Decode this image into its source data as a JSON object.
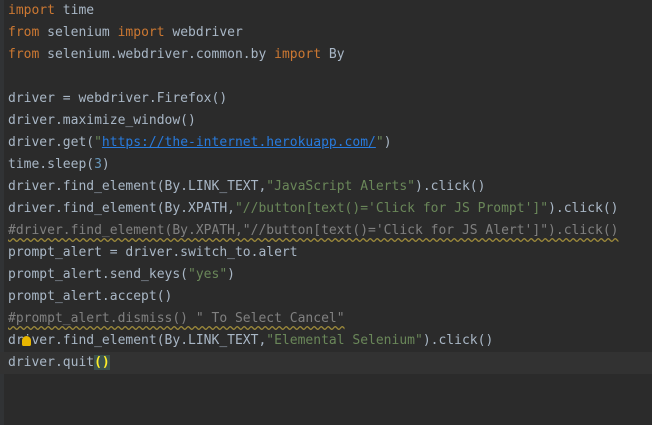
{
  "colors": {
    "background": "#2b2b2b",
    "keyword": "#cc7832",
    "string": "#6a8759",
    "comment": "#808080",
    "link": "#287bde",
    "default": "#a9b7c6"
  },
  "code": {
    "l1": {
      "kw1": "import",
      "rest": " time"
    },
    "l2": {
      "kw1": "from",
      "mid": " selenium ",
      "kw2": "import",
      "rest": " webdriver"
    },
    "l3": {
      "kw1": "from",
      "mid": " selenium.webdriver.common.by ",
      "kw2": "import",
      "rest": " By"
    },
    "l5": "driver = webdriver.Firefox()",
    "l6": "driver.maximize_window()",
    "l7": {
      "pre": "driver.get(",
      "q1": "\"",
      "url": "https://the-internet.herokuapp.com/",
      "q2": "\"",
      "post": ")"
    },
    "l8": {
      "pre": "time.sleep(",
      "num": "3",
      "post": ")"
    },
    "l9": {
      "pre": "driver.find_element(By.LINK_TEXT,",
      "str": "\"JavaScript Alerts\"",
      "post": ").click()"
    },
    "l10": {
      "pre": "driver.find_element(By.XPATH,",
      "str": "\"//button[text()='Click for JS Prompt']\"",
      "post": ").click()"
    },
    "l11": "#driver.find_element(By.XPATH,\"//button[text()='Click for JS Alert']\").click()",
    "l12": "prompt_alert = driver.switch_to.alert",
    "l13": {
      "pre": "prompt_alert.send_keys(",
      "str": "\"yes\"",
      "post": ")"
    },
    "l14": "prompt_alert.accept()",
    "l15": "#prompt_alert.dismiss() \" To Select Cancel\"",
    "l16": {
      "pre1": "d",
      "pre2": "river.find_element(By.LINK_TEXT,",
      "str": "\"Elemental Selenium\"",
      "post": ").click()"
    },
    "l17": {
      "pre": "driver.quit",
      "paren": "()"
    }
  },
  "markers": {
    "warning_mark": "^",
    "intention_icon": "bulb-icon"
  }
}
